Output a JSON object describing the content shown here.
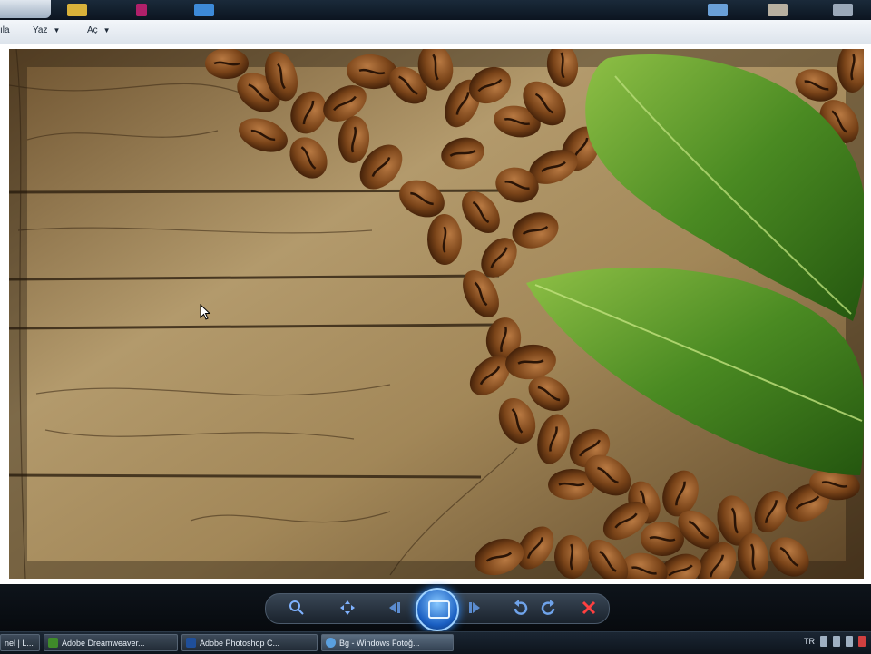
{
  "menubar": {
    "items": [
      {
        "label": "ıla"
      },
      {
        "label": "Yaz"
      },
      {
        "label": "Aç"
      }
    ]
  },
  "taskbar": {
    "items": [
      {
        "label": "nel | L..."
      },
      {
        "label": "Adobe Dreamweaver..."
      },
      {
        "label": "Adobe Photoshop C..."
      },
      {
        "label": "Bg - Windows Fotoğ..."
      }
    ],
    "language": "TR"
  },
  "icons": {
    "zoom": "magnifier-icon",
    "fit": "fit-window-icon",
    "previous": "previous-icon",
    "slideshow": "slideshow-icon",
    "next": "next-icon",
    "rotate_left": "rotate-ccw-icon",
    "rotate_right": "rotate-cw-icon",
    "delete": "delete-x-icon"
  },
  "colors": {
    "accent_blue": "#2d8cff",
    "delete_red": "#ff4040"
  }
}
